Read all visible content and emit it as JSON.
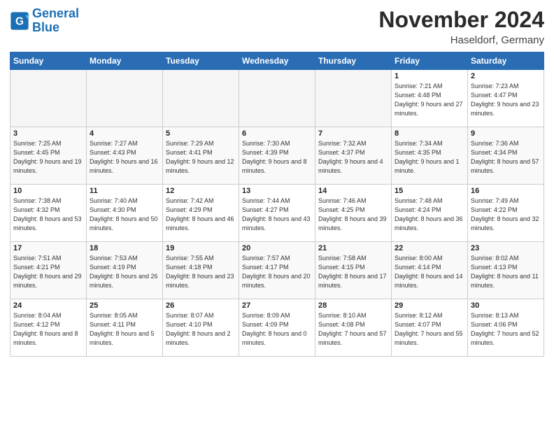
{
  "header": {
    "logo_general": "General",
    "logo_blue": "Blue",
    "month_title": "November 2024",
    "location": "Haseldorf, Germany"
  },
  "days_of_week": [
    "Sunday",
    "Monday",
    "Tuesday",
    "Wednesday",
    "Thursday",
    "Friday",
    "Saturday"
  ],
  "weeks": [
    [
      {
        "day": "",
        "empty": true
      },
      {
        "day": "",
        "empty": true
      },
      {
        "day": "",
        "empty": true
      },
      {
        "day": "",
        "empty": true
      },
      {
        "day": "",
        "empty": true
      },
      {
        "day": "1",
        "sunrise": "7:21 AM",
        "sunset": "4:48 PM",
        "daylight": "9 hours and 27 minutes."
      },
      {
        "day": "2",
        "sunrise": "7:23 AM",
        "sunset": "4:47 PM",
        "daylight": "9 hours and 23 minutes."
      }
    ],
    [
      {
        "day": "3",
        "sunrise": "7:25 AM",
        "sunset": "4:45 PM",
        "daylight": "9 hours and 19 minutes."
      },
      {
        "day": "4",
        "sunrise": "7:27 AM",
        "sunset": "4:43 PM",
        "daylight": "9 hours and 16 minutes."
      },
      {
        "day": "5",
        "sunrise": "7:29 AM",
        "sunset": "4:41 PM",
        "daylight": "9 hours and 12 minutes."
      },
      {
        "day": "6",
        "sunrise": "7:30 AM",
        "sunset": "4:39 PM",
        "daylight": "9 hours and 8 minutes."
      },
      {
        "day": "7",
        "sunrise": "7:32 AM",
        "sunset": "4:37 PM",
        "daylight": "9 hours and 4 minutes."
      },
      {
        "day": "8",
        "sunrise": "7:34 AM",
        "sunset": "4:35 PM",
        "daylight": "9 hours and 1 minute."
      },
      {
        "day": "9",
        "sunrise": "7:36 AM",
        "sunset": "4:34 PM",
        "daylight": "8 hours and 57 minutes."
      }
    ],
    [
      {
        "day": "10",
        "sunrise": "7:38 AM",
        "sunset": "4:32 PM",
        "daylight": "8 hours and 53 minutes."
      },
      {
        "day": "11",
        "sunrise": "7:40 AM",
        "sunset": "4:30 PM",
        "daylight": "8 hours and 50 minutes."
      },
      {
        "day": "12",
        "sunrise": "7:42 AM",
        "sunset": "4:29 PM",
        "daylight": "8 hours and 46 minutes."
      },
      {
        "day": "13",
        "sunrise": "7:44 AM",
        "sunset": "4:27 PM",
        "daylight": "8 hours and 43 minutes."
      },
      {
        "day": "14",
        "sunrise": "7:46 AM",
        "sunset": "4:25 PM",
        "daylight": "8 hours and 39 minutes."
      },
      {
        "day": "15",
        "sunrise": "7:48 AM",
        "sunset": "4:24 PM",
        "daylight": "8 hours and 36 minutes."
      },
      {
        "day": "16",
        "sunrise": "7:49 AM",
        "sunset": "4:22 PM",
        "daylight": "8 hours and 32 minutes."
      }
    ],
    [
      {
        "day": "17",
        "sunrise": "7:51 AM",
        "sunset": "4:21 PM",
        "daylight": "8 hours and 29 minutes."
      },
      {
        "day": "18",
        "sunrise": "7:53 AM",
        "sunset": "4:19 PM",
        "daylight": "8 hours and 26 minutes."
      },
      {
        "day": "19",
        "sunrise": "7:55 AM",
        "sunset": "4:18 PM",
        "daylight": "8 hours and 23 minutes."
      },
      {
        "day": "20",
        "sunrise": "7:57 AM",
        "sunset": "4:17 PM",
        "daylight": "8 hours and 20 minutes."
      },
      {
        "day": "21",
        "sunrise": "7:58 AM",
        "sunset": "4:15 PM",
        "daylight": "8 hours and 17 minutes."
      },
      {
        "day": "22",
        "sunrise": "8:00 AM",
        "sunset": "4:14 PM",
        "daylight": "8 hours and 14 minutes."
      },
      {
        "day": "23",
        "sunrise": "8:02 AM",
        "sunset": "4:13 PM",
        "daylight": "8 hours and 11 minutes."
      }
    ],
    [
      {
        "day": "24",
        "sunrise": "8:04 AM",
        "sunset": "4:12 PM",
        "daylight": "8 hours and 8 minutes."
      },
      {
        "day": "25",
        "sunrise": "8:05 AM",
        "sunset": "4:11 PM",
        "daylight": "8 hours and 5 minutes."
      },
      {
        "day": "26",
        "sunrise": "8:07 AM",
        "sunset": "4:10 PM",
        "daylight": "8 hours and 2 minutes."
      },
      {
        "day": "27",
        "sunrise": "8:09 AM",
        "sunset": "4:09 PM",
        "daylight": "8 hours and 0 minutes."
      },
      {
        "day": "28",
        "sunrise": "8:10 AM",
        "sunset": "4:08 PM",
        "daylight": "7 hours and 57 minutes."
      },
      {
        "day": "29",
        "sunrise": "8:12 AM",
        "sunset": "4:07 PM",
        "daylight": "7 hours and 55 minutes."
      },
      {
        "day": "30",
        "sunrise": "8:13 AM",
        "sunset": "4:06 PM",
        "daylight": "7 hours and 52 minutes."
      }
    ]
  ]
}
